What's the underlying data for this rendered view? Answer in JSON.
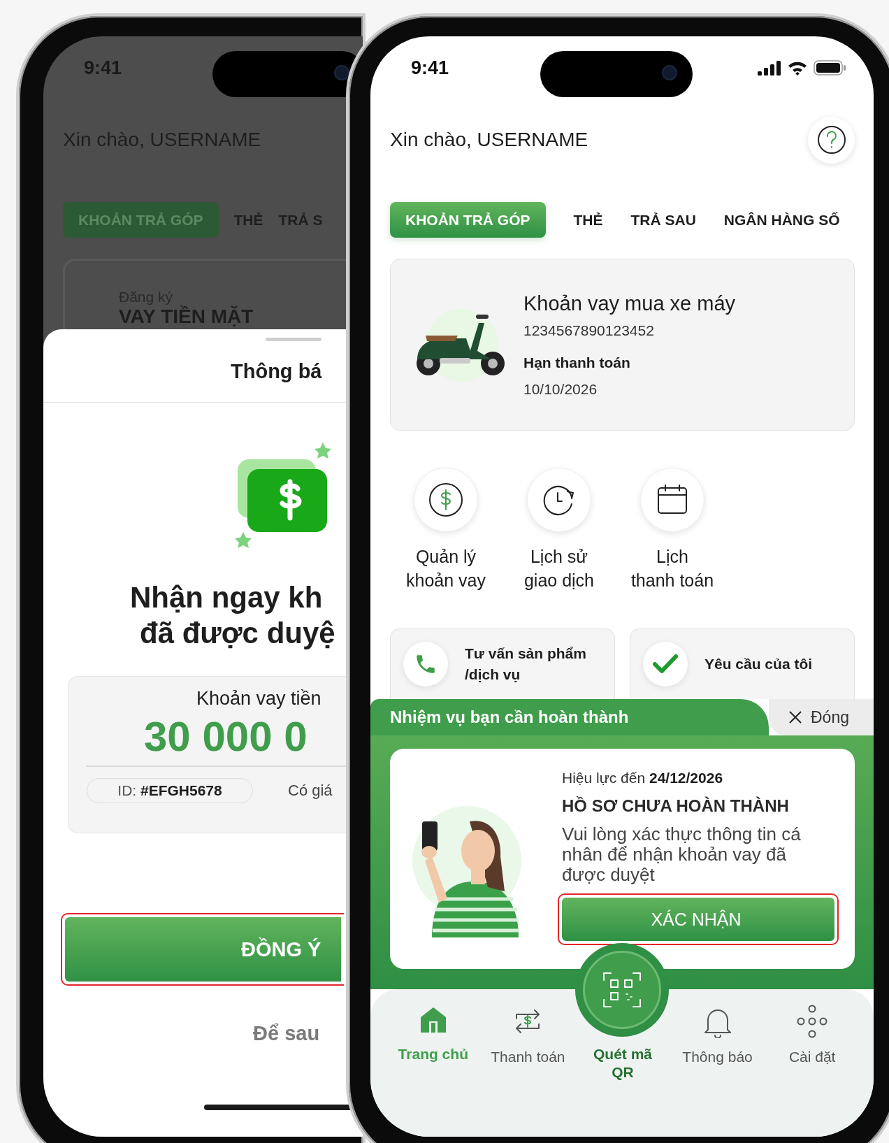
{
  "left_phone": {
    "time": "9:41",
    "greeting": "Xin chào, USERNAME",
    "tabs": [
      {
        "label": "KHOẢN TRẢ GÓP",
        "selected": true
      },
      {
        "label": "THẺ",
        "selected": false
      },
      {
        "label": "TRẢ S",
        "selected": false
      }
    ],
    "promo": {
      "caption": "Đăng ký",
      "title": "VAY TIỀN MẶT"
    },
    "sheet": {
      "title": "Thông bá",
      "heading": [
        "Nhận ngay kh",
        "đã được duyệ"
      ],
      "amount_label": "Khoản vay tiền",
      "amount": "30 000 0",
      "id": "ID: **#EFGH5678**",
      "validity": "Có giá",
      "primary_button": {
        "label": "ĐỒNG Ý",
        "highlighted": true
      },
      "secondary_button": "Để sau"
    }
  },
  "right_phone": {
    "time": "9:41",
    "greeting": "Xin chào, USERNAME",
    "tabs": [
      {
        "label": "KHOẢN TRẢ GÓP",
        "selected": true
      },
      {
        "label": "THẺ",
        "selected": false
      },
      {
        "label": "TRẢ SAU",
        "selected": false
      },
      {
        "label": "NGÂN HÀNG SỐ",
        "selected": false
      }
    ],
    "loan_card": {
      "title": "Khoản vay mua xe máy",
      "number": "1234567890123452",
      "due_label": "Hạn thanh toán",
      "due_date": "10/10/2026"
    },
    "actions": [
      {
        "kind": "dollar",
        "lines": [
          "Quản lý",
          "khoản vay"
        ]
      },
      {
        "kind": "history",
        "lines": [
          "Lịch sử",
          "giao dịch"
        ]
      },
      {
        "kind": "calendar",
        "lines": [
          "Lịch",
          "thanh toán"
        ]
      }
    ],
    "shortcuts": [
      {
        "kind": "phone",
        "lines": [
          "Tư vấn sản phẩm",
          "/dịch vụ"
        ]
      },
      {
        "kind": "check",
        "lines": [
          "Yêu cầu của tôi"
        ]
      }
    ],
    "task_panel": {
      "title": "Nhiệm vụ bạn cần hoàn thành",
      "close_label": "Đóng",
      "validity": "Hiệu lực đến **24/12/2026**",
      "heading": "HỒ SƠ CHƯA HOÀN THÀNH",
      "message": "Vui lòng xác thực thông tin cá nhân để nhận khoản vay đã được duyệt",
      "button": {
        "label": "XÁC NHẬN",
        "highlighted": true
      }
    },
    "nav": [
      {
        "kind": "home",
        "label": "Trang chủ",
        "selected": true
      },
      {
        "kind": "transfer",
        "label": "Thanh toán",
        "selected": false
      },
      {
        "kind": "qr",
        "label": "Quét mã QR",
        "selected": false
      },
      {
        "kind": "bell",
        "label": "Thông báo",
        "selected": false
      },
      {
        "kind": "dots",
        "label": "Cài đặt",
        "selected": false
      }
    ]
  }
}
